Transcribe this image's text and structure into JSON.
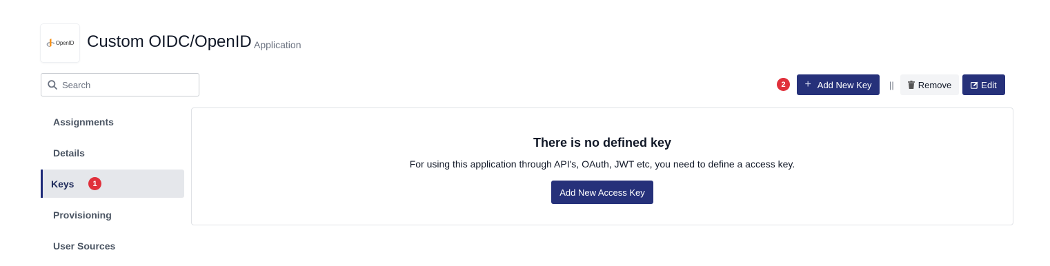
{
  "header": {
    "logo_text": "OpenID",
    "title": "Custom OIDC/OpenID",
    "subtitle": "Application"
  },
  "search": {
    "placeholder": "Search",
    "value": ""
  },
  "sidebar": {
    "items": [
      {
        "label": "Assignments",
        "active": false
      },
      {
        "label": "Details",
        "active": false
      },
      {
        "label": "Keys",
        "active": true,
        "badge": "1"
      },
      {
        "label": "Provisioning",
        "active": false
      },
      {
        "label": "User Sources",
        "active": false
      }
    ]
  },
  "toolbar": {
    "badge": "2",
    "add_key_label": "Add New Key",
    "separator": "||",
    "remove_label": "Remove",
    "edit_label": "Edit"
  },
  "empty_state": {
    "title": "There is no defined key",
    "description": "For using this application through API's, OAuth, JWT etc, you need to define a access key.",
    "button_label": "Add New Access Key"
  },
  "colors": {
    "primary": "#26317a",
    "badge": "#e0303b",
    "active_nav_bg": "#e5e7eb",
    "logo_accent": "#f7941d"
  }
}
